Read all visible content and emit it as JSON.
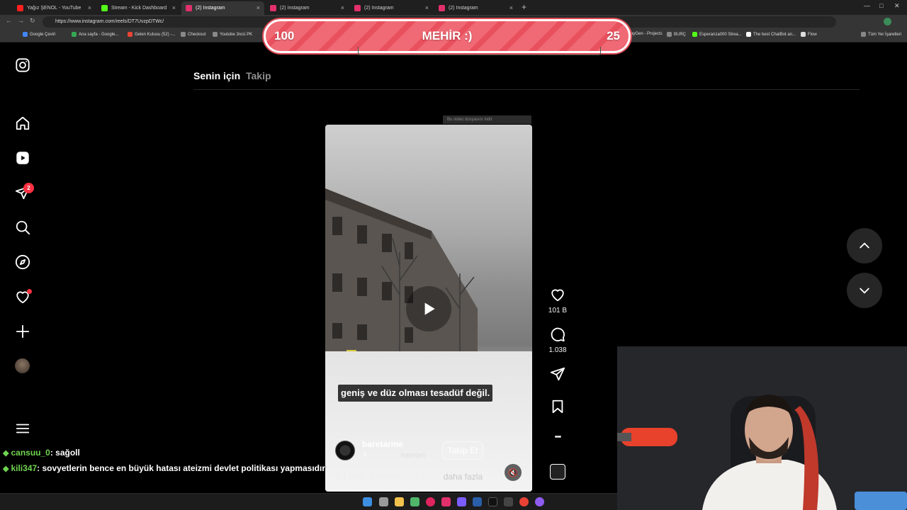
{
  "browser": {
    "tabs": [
      {
        "title": "Yağız ŞENOL - YouTube",
        "color": "#ff2020"
      },
      {
        "title": "Stream - Kick Dashboard",
        "color": "#53fc18"
      },
      {
        "title": "(2) Instagram",
        "color": "#e1306c"
      },
      {
        "title": "(2) Instagram",
        "color": "#e1306c"
      },
      {
        "title": "(2) Instagram",
        "color": "#e1306c"
      },
      {
        "title": "(2) Instagram",
        "color": "#e1306c"
      }
    ],
    "url": "https://www.instagram.com/reels/DT7UvzpDTWc/",
    "bookmarks": [
      "Google Çeviri",
      "Ana sayfa - Google...",
      "Gelen Kutusu (52) -...",
      "Checkout",
      "Youtube 3ncü PK",
      "ayGen - Projects",
      "BURÇ",
      "Esperanza000 Strea...",
      "The best ChatBot an...",
      "Flow",
      "Tüm Yer İşaretleri"
    ],
    "close_glyph": "×",
    "new_tab_glyph": "+"
  },
  "goal_bar": {
    "left": "100",
    "title": "MEHİR :)",
    "right": "25",
    "progress": 0.25
  },
  "sidebar": {
    "notification_count": "2"
  },
  "feed": {
    "tab_for_you": "Senin için",
    "tab_following": "Takip"
  },
  "video": {
    "download_hint": "Bu video dosyasını indir",
    "subtitle": "geniş ve düz olması tesadüf değil.",
    "author": "baretarme",
    "music": "baretarı",
    "music_icon": "♬",
    "follow_label": "Takip Et",
    "caption": "Bu şehri diğerlerinden ayı ...",
    "caption_more": "daha fazla",
    "mute_icon": "🔇"
  },
  "actions": {
    "likes": "101 B",
    "comments": "1.038",
    "more": "•••"
  },
  "chat": [
    {
      "user": "cansuu_0",
      "message": ": sağoll"
    },
    {
      "user": "kili347",
      "message": ": sovyetlerin bence en büyük hatası ateizmi devlet politikası yapmasıdır"
    }
  ],
  "chat_badge": "◆"
}
